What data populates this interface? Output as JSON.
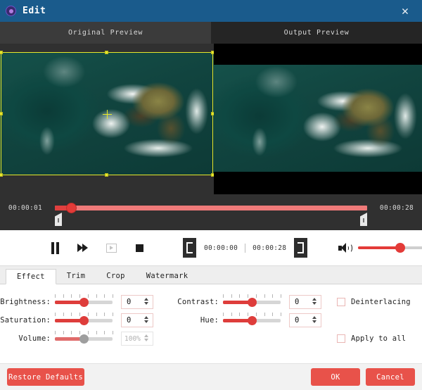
{
  "window": {
    "title": "Edit",
    "app_icon": "circle-app-icon",
    "close_icon": "close-icon",
    "titlebar_color": "#1a5b8c"
  },
  "previews": {
    "original_label": "Original Preview",
    "output_label": "Output Preview",
    "crop_overlay_color": "#e8e82a"
  },
  "timeline": {
    "start_time": "00:00:01",
    "end_time": "00:00:28",
    "track_color": "#ef7a79",
    "knob_color": "#e33b38"
  },
  "controls": {
    "pause_icon": "pause-icon",
    "fast_forward_icon": "fast-forward-icon",
    "frame_step_icon": "frame-step-icon",
    "stop_icon": "stop-icon",
    "mark_in_icon": "mark-in-bracket-icon",
    "mark_out_icon": "mark-out-bracket-icon",
    "current_time": "00:00:00",
    "total_time": "00:00:28",
    "speaker_icon": "speaker-icon",
    "volume_percent": 50
  },
  "tabs": [
    {
      "label": "Effect",
      "active": true
    },
    {
      "label": "Trim",
      "active": false
    },
    {
      "label": "Crop",
      "active": false
    },
    {
      "label": "Watermark",
      "active": false
    }
  ],
  "effect": {
    "brightness": {
      "label": "Brightness:",
      "value": "0",
      "percent": 50
    },
    "saturation": {
      "label": "Saturation:",
      "value": "0",
      "percent": 50
    },
    "volume": {
      "label": "Volume:",
      "value": "100%",
      "percent": 50,
      "disabled": true
    },
    "contrast": {
      "label": "Contrast:",
      "value": "0",
      "percent": 50
    },
    "hue": {
      "label": "Hue:",
      "value": "0",
      "percent": 50
    },
    "deinterlacing": {
      "label": "Deinterlacing",
      "checked": false
    },
    "apply_to_all": {
      "label": "Apply to all",
      "checked": false
    }
  },
  "footer": {
    "restore_label": "Restore Defaults",
    "ok_label": "OK",
    "cancel_label": "Cancel",
    "button_color": "#e8524a"
  }
}
